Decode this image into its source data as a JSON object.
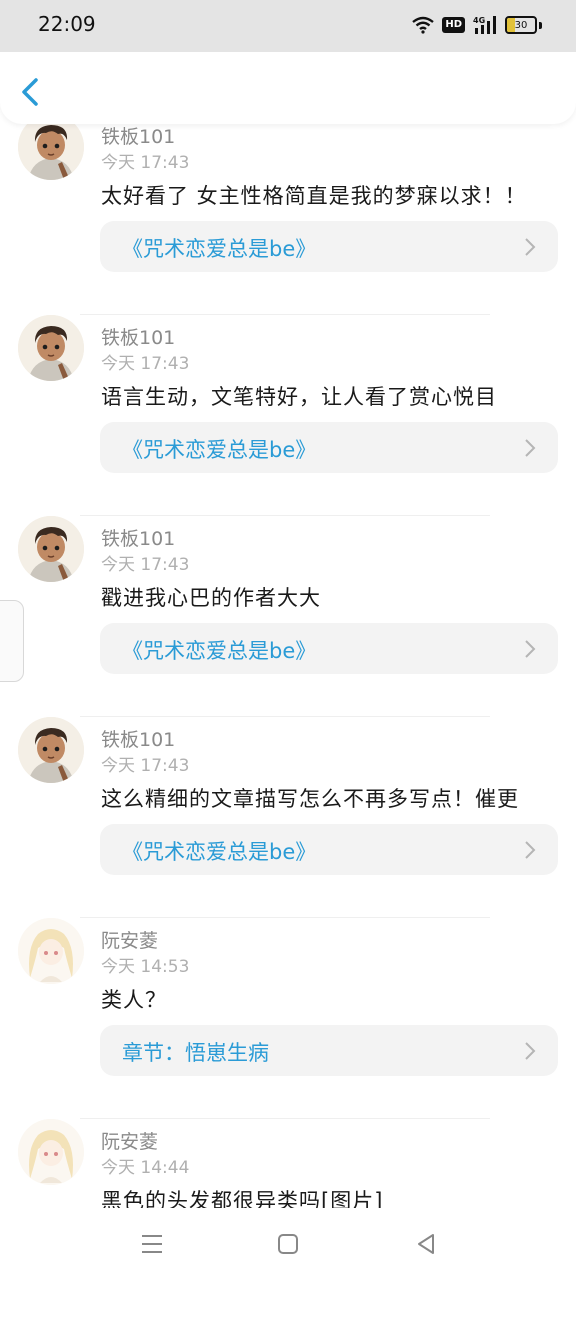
{
  "status_bar": {
    "time": "22:09",
    "network": "4G",
    "hd": "HD",
    "battery": "30"
  },
  "comments": [
    {
      "user": "铁板101",
      "time": "今天 17:43",
      "text": "太好看了 女主性格简直是我的梦寐以求！！",
      "link": "《咒术恋爱总是be》",
      "avatar": "avatar-boy"
    },
    {
      "user": "铁板101",
      "time": "今天 17:43",
      "text": "语言生动，文笔特好，让人看了赏心悦目",
      "link": "《咒术恋爱总是be》",
      "avatar": "avatar-boy"
    },
    {
      "user": "铁板101",
      "time": "今天 17:43",
      "text": "戳进我心巴的作者大大",
      "link": "《咒术恋爱总是be》",
      "avatar": "avatar-boy"
    },
    {
      "user": "铁板101",
      "time": "今天 17:43",
      "text": "这么精细的文章描写怎么不再多写点！催更",
      "link": "《咒术恋爱总是be》",
      "avatar": "avatar-boy"
    },
    {
      "user": "阮安菱",
      "time": "今天 14:53",
      "text": "类人？",
      "link": "章节：悟崽生病",
      "avatar": "avatar-girl"
    },
    {
      "user": "阮安菱",
      "time": "今天 14:44",
      "text": "黑色的头发都很异类吗[图片]",
      "link": "",
      "avatar": "avatar-girl"
    }
  ],
  "colors": {
    "link": "#2a9bd6",
    "accent": "#2a9bd6"
  }
}
